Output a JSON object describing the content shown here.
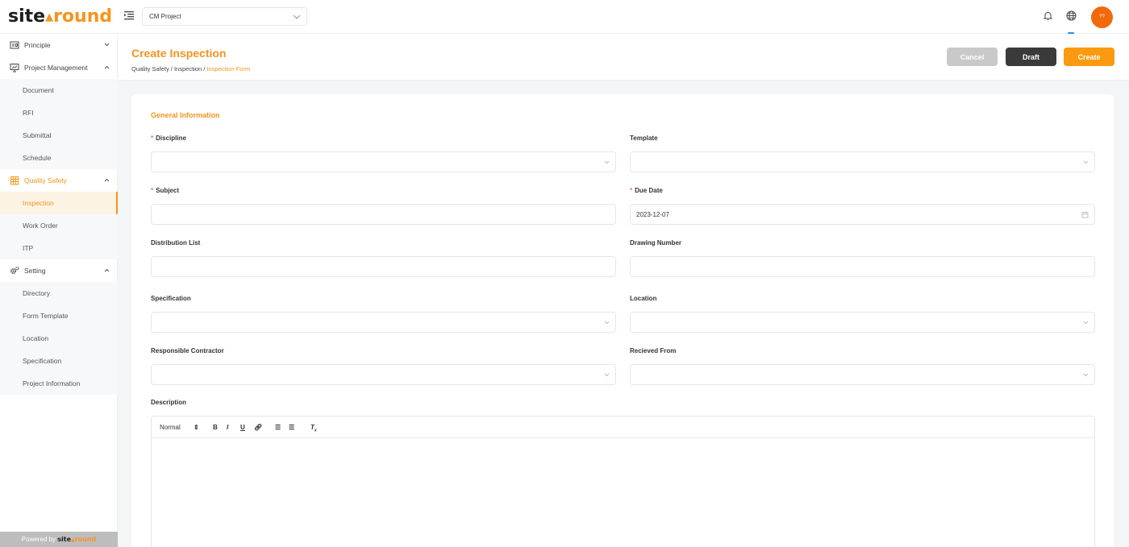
{
  "brand": {
    "part1": "site",
    "part2": "round",
    "accent": "#f7941d"
  },
  "header": {
    "project": "CM Project",
    "avatar_text": "??"
  },
  "sidebar": {
    "principle": "Principle",
    "project_management": "Project Management",
    "pm_items": [
      "Document",
      "RFI",
      "Submittal",
      "Schedule"
    ],
    "quality_safety": "Quality Safety",
    "qs_items": [
      "Inspection",
      "Work Order",
      "ITP"
    ],
    "setting": "Setting",
    "setting_items": [
      "Directory",
      "Form Template",
      "Location",
      "Specification",
      "Project Information"
    ],
    "powered_by": "Powered by"
  },
  "page": {
    "title": "Create Inspection",
    "breadcrumb": [
      "Quality Safety",
      "Inspection",
      "Inspection Form"
    ],
    "cancel": "Cancel",
    "draft": "Draft",
    "create": "Create"
  },
  "form": {
    "section": "General Information",
    "discipline": "Discipline",
    "template": "Template",
    "subject": "Subject",
    "due_date": "Due Date",
    "due_date_value": "2023-12-07",
    "distribution_list": "Distribution List",
    "drawing_number": "Drawing Number",
    "specification": "Specification",
    "location": "Location",
    "responsible_contractor": "Responsible Contractor",
    "received_from": "Recieved From",
    "description": "Description",
    "editor_style": "Normal"
  }
}
